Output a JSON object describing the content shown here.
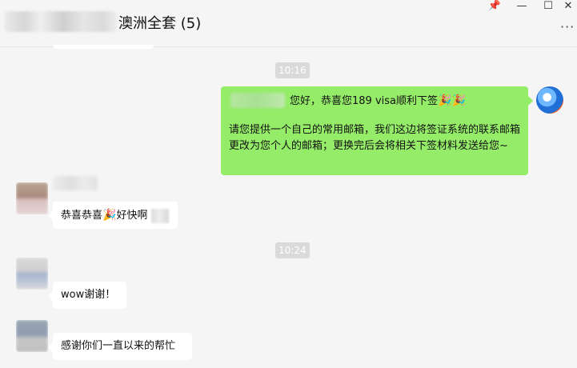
{
  "window": {
    "title": "澳洲全套 (5)",
    "controls": {
      "pin": "📌",
      "minimize": "—",
      "maximize": "☐",
      "close": "✕",
      "more": "···"
    }
  },
  "messages": {
    "time1": "10:16",
    "me_line1": "您好，恭喜您189 visa顺利下签",
    "me_emoji": "🎉",
    "me_line2": "请您提供一个自己的常用邮箱，我们这边将签证系统的联系邮箱更改为您个人的邮箱；更换完后会将相关下签材料发送给您~",
    "msg1_text": "恭喜恭喜",
    "msg1_emoji": "🎉",
    "msg1_text2": "好快啊",
    "time2": "10:24",
    "msg2_text": "wow谢谢！",
    "msg3_text": "感谢你们一直以来的帮忙"
  },
  "colors": {
    "my_bubble": "#95ec69",
    "other_bubble": "#ffffff",
    "background": "#f5f5f5"
  }
}
